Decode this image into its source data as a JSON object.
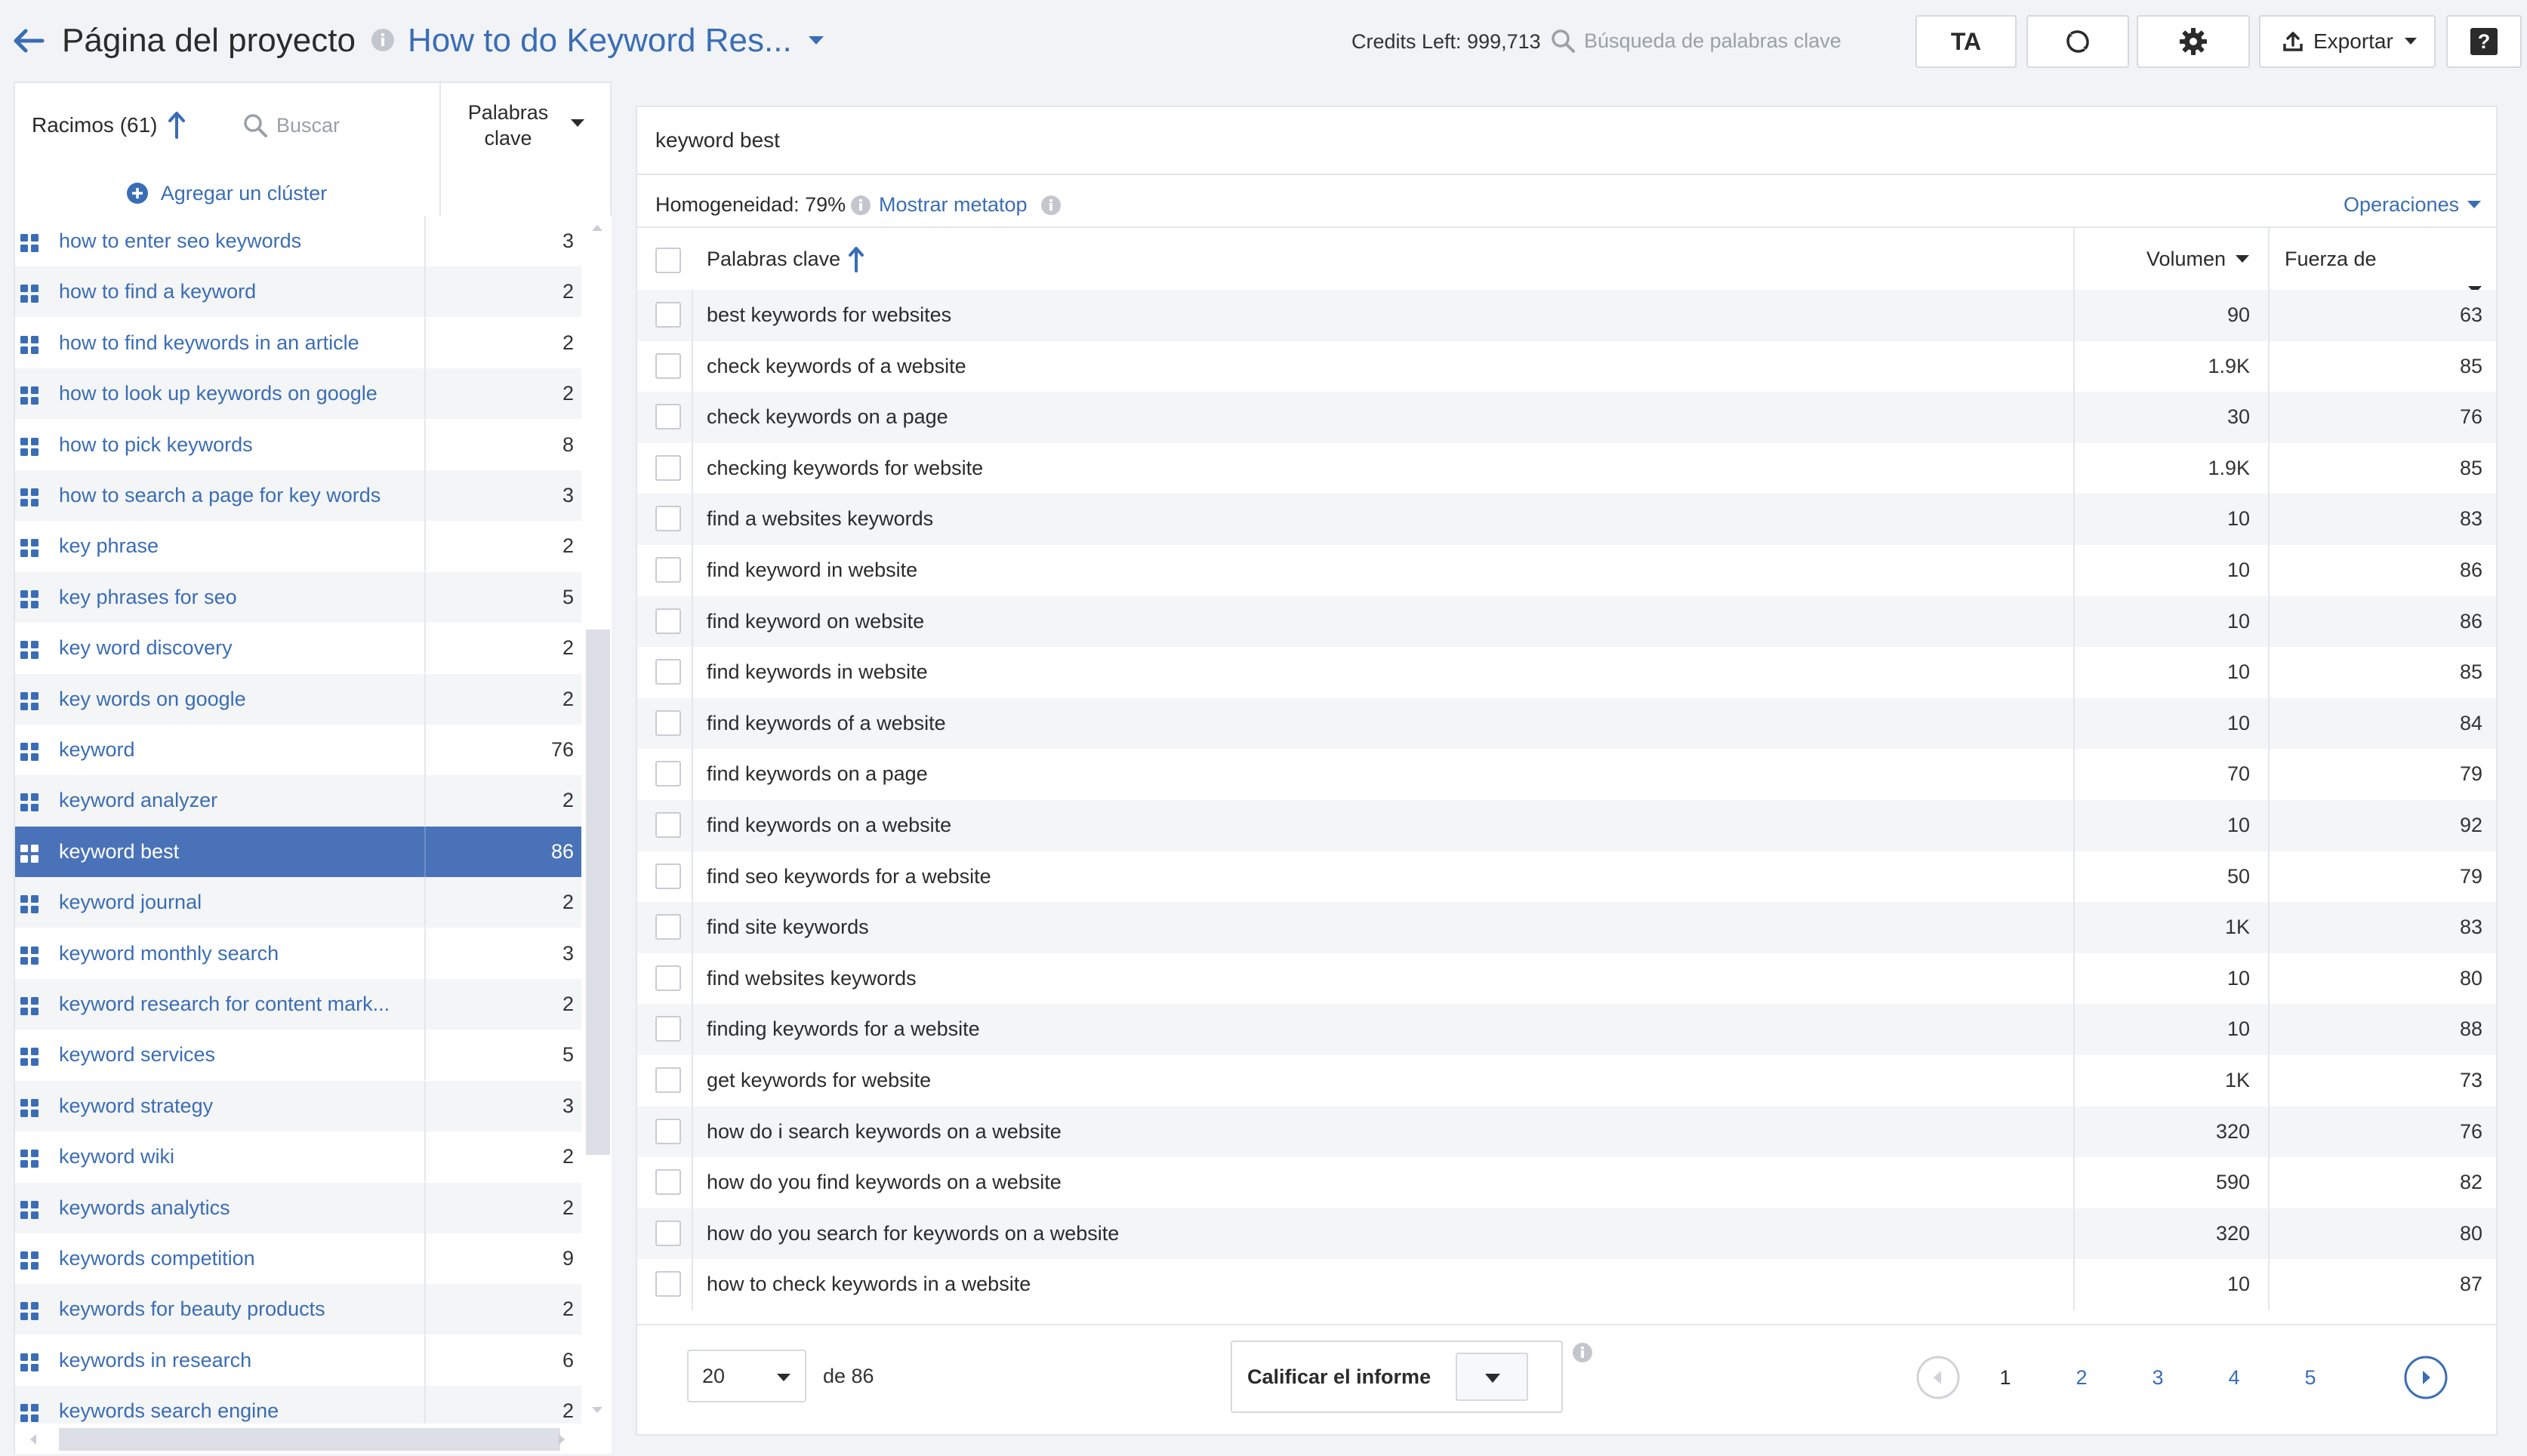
{
  "header": {
    "page_title": "Página del proyecto",
    "project_name": "How to do Keyword Res...",
    "credits_text": "Credits Left: 999,713",
    "search_placeholder": "Búsqueda de palabras clave",
    "ta_label": "TA",
    "export_label": "Exportar",
    "help_label": "?"
  },
  "left": {
    "clusters_label": "Racimos (61)",
    "search_placeholder": "Buscar",
    "col_keywords": "Palabras clave",
    "add_cluster": "Agregar un clúster",
    "rows": [
      {
        "name": "how to enter seo keywords",
        "count": "3"
      },
      {
        "name": "how to find a keyword",
        "count": "2"
      },
      {
        "name": "how to find keywords in an article",
        "count": "2"
      },
      {
        "name": "how to look up keywords on google",
        "count": "2"
      },
      {
        "name": "how to pick keywords",
        "count": "8"
      },
      {
        "name": "how to search a page for key words",
        "count": "3"
      },
      {
        "name": "key phrase",
        "count": "2"
      },
      {
        "name": "key phrases for seo",
        "count": "5"
      },
      {
        "name": "key word discovery",
        "count": "2"
      },
      {
        "name": "key words on google",
        "count": "2"
      },
      {
        "name": "keyword",
        "count": "76"
      },
      {
        "name": "keyword analyzer",
        "count": "2"
      },
      {
        "name": "keyword best",
        "count": "86"
      },
      {
        "name": "keyword journal",
        "count": "2"
      },
      {
        "name": "keyword monthly search",
        "count": "3"
      },
      {
        "name": "keyword research for content mark...",
        "count": "2"
      },
      {
        "name": "keyword services",
        "count": "5"
      },
      {
        "name": "keyword strategy",
        "count": "3"
      },
      {
        "name": "keyword wiki",
        "count": "2"
      },
      {
        "name": "keywords analytics",
        "count": "2"
      },
      {
        "name": "keywords competition",
        "count": "9"
      },
      {
        "name": "keywords for beauty products",
        "count": "2"
      },
      {
        "name": "keywords in research",
        "count": "6"
      },
      {
        "name": "keywords search engine",
        "count": "2"
      }
    ],
    "selected_index": 12
  },
  "right": {
    "cluster_title": "keyword best",
    "homogeneity": "Homogeneidad: 79%",
    "show_metatop": "Mostrar metatop",
    "operations": "Operaciones",
    "col_keywords": "Palabras clave",
    "col_volume": "Volumen",
    "col_strength": "Fuerza de conexión, %",
    "rows": [
      {
        "kw": "best keywords for websites",
        "vol": "90",
        "fc": "63"
      },
      {
        "kw": "check keywords of a website",
        "vol": "1.9K",
        "fc": "85"
      },
      {
        "kw": "check keywords on a page",
        "vol": "30",
        "fc": "76"
      },
      {
        "kw": "checking keywords for website",
        "vol": "1.9K",
        "fc": "85"
      },
      {
        "kw": "find a websites keywords",
        "vol": "10",
        "fc": "83"
      },
      {
        "kw": "find keyword in website",
        "vol": "10",
        "fc": "86"
      },
      {
        "kw": "find keyword on website",
        "vol": "10",
        "fc": "86"
      },
      {
        "kw": "find keywords in website",
        "vol": "10",
        "fc": "85"
      },
      {
        "kw": "find keywords of a website",
        "vol": "10",
        "fc": "84"
      },
      {
        "kw": "find keywords on a page",
        "vol": "70",
        "fc": "79"
      },
      {
        "kw": "find keywords on a website",
        "vol": "10",
        "fc": "92"
      },
      {
        "kw": "find seo keywords for a website",
        "vol": "50",
        "fc": "79"
      },
      {
        "kw": "find site keywords",
        "vol": "1K",
        "fc": "83"
      },
      {
        "kw": "find websites keywords",
        "vol": "10",
        "fc": "80"
      },
      {
        "kw": "finding keywords for a website",
        "vol": "10",
        "fc": "88"
      },
      {
        "kw": "get keywords for website",
        "vol": "1K",
        "fc": "73"
      },
      {
        "kw": "how do i search keywords on a website",
        "vol": "320",
        "fc": "76"
      },
      {
        "kw": "how do you find keywords on a website",
        "vol": "590",
        "fc": "82"
      },
      {
        "kw": "how do you search for keywords on a website",
        "vol": "320",
        "fc": "80"
      },
      {
        "kw": "how to check keywords in a website",
        "vol": "10",
        "fc": "87"
      }
    ],
    "footer": {
      "page_size": "20",
      "of_total": "de 86",
      "rate_report": "Calificar el informe",
      "pages": [
        "1",
        "2",
        "3",
        "4",
        "5"
      ],
      "current_page": "1"
    }
  },
  "colors": {
    "accent": "#3a6db5",
    "selected_row": "#4a72b8",
    "zebra": "#f4f5f7"
  }
}
